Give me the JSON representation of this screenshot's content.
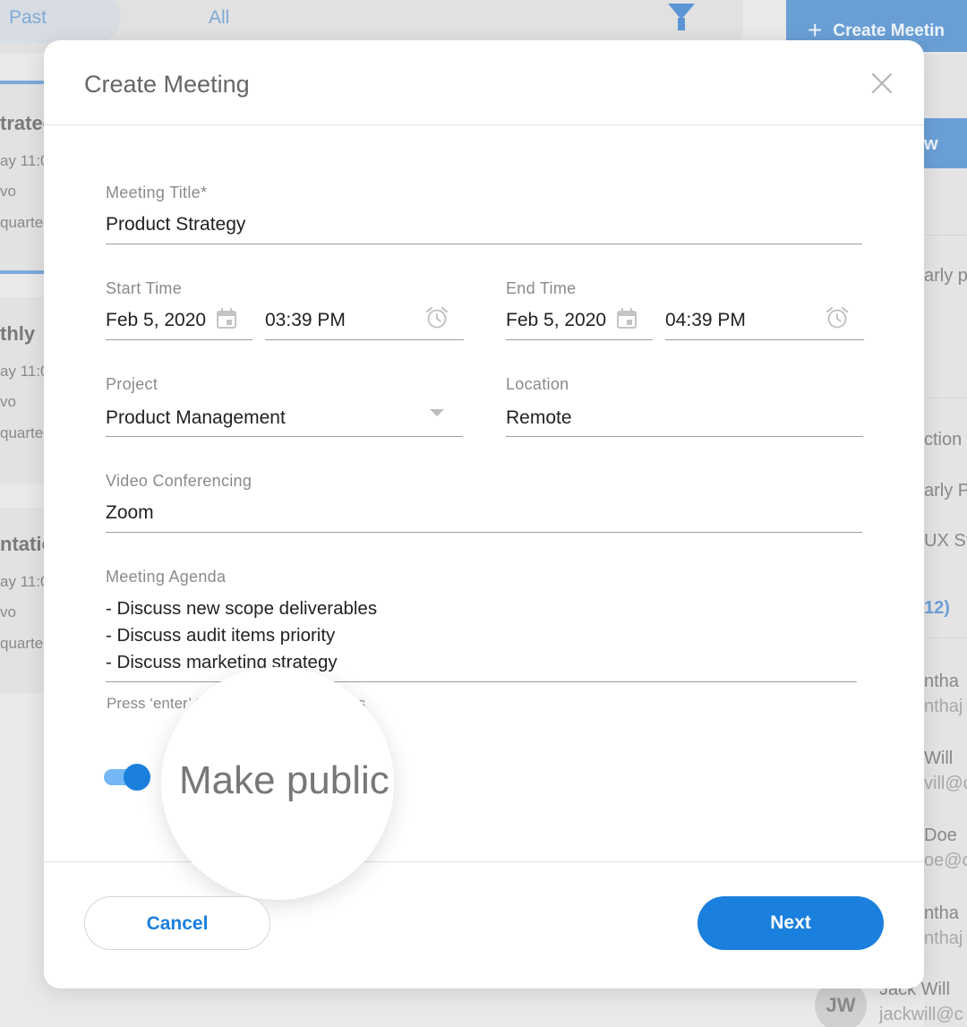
{
  "background": {
    "tabs": [
      "Past",
      "All"
    ],
    "create_button": "Create Meetin",
    "cards": [
      {
        "title": "trateg",
        "date": "ay 11:0",
        "line2": "vo",
        "line3": "quarte"
      },
      {
        "title": "thly",
        "date": "ay 11:0",
        "line2": "vo",
        "line3": "quarte"
      },
      {
        "title": "ntatio",
        "date": "ay 11:0",
        "line2": "vo",
        "line3": "quarte"
      }
    ],
    "right_panel": {
      "button_fragment": "w",
      "early_1": "arly p",
      "section": "ction",
      "early_2": "arly P",
      "ux": "UX St",
      "count": "12)",
      "people": [
        {
          "name": "ntha",
          "email": "nthaj"
        },
        {
          "name": "Will",
          "email": "vill@c"
        },
        {
          "name": "Doe",
          "email": "oe@c"
        },
        {
          "name": "ntha",
          "email": "nthaj"
        },
        {
          "name": "Jack Will",
          "email": "jackwill@c",
          "initials": "JW"
        }
      ]
    }
  },
  "modal": {
    "title": "Create Meeting",
    "meeting_title": {
      "label": "Meeting Title*",
      "value": "Product Strategy"
    },
    "start_time": {
      "label": "Start Time",
      "date": "Feb 5, 2020",
      "time": "03:39 PM"
    },
    "end_time": {
      "label": "End Time",
      "date": "Feb 5, 2020",
      "time": "04:39 PM"
    },
    "project": {
      "label": "Project",
      "value": "Product Management"
    },
    "location": {
      "label": "Location",
      "value": "Remote"
    },
    "video_conferencing": {
      "label": "Video Conferencing",
      "value": "Zoom"
    },
    "agenda": {
      "label": "Meeting Agenda",
      "items": [
        "- Discuss new scope deliverables",
        "- Discuss audit items priority",
        "- Discuss marketing strategy"
      ],
      "hint": "Press ‘enter’ to add new agenda items"
    },
    "make_public": {
      "label": "Make public",
      "checked": true
    },
    "cancel_label": "Cancel",
    "next_label": "Next"
  },
  "colors": {
    "accent": "#1a7fdd",
    "toggle_track": "#73b8f4"
  }
}
